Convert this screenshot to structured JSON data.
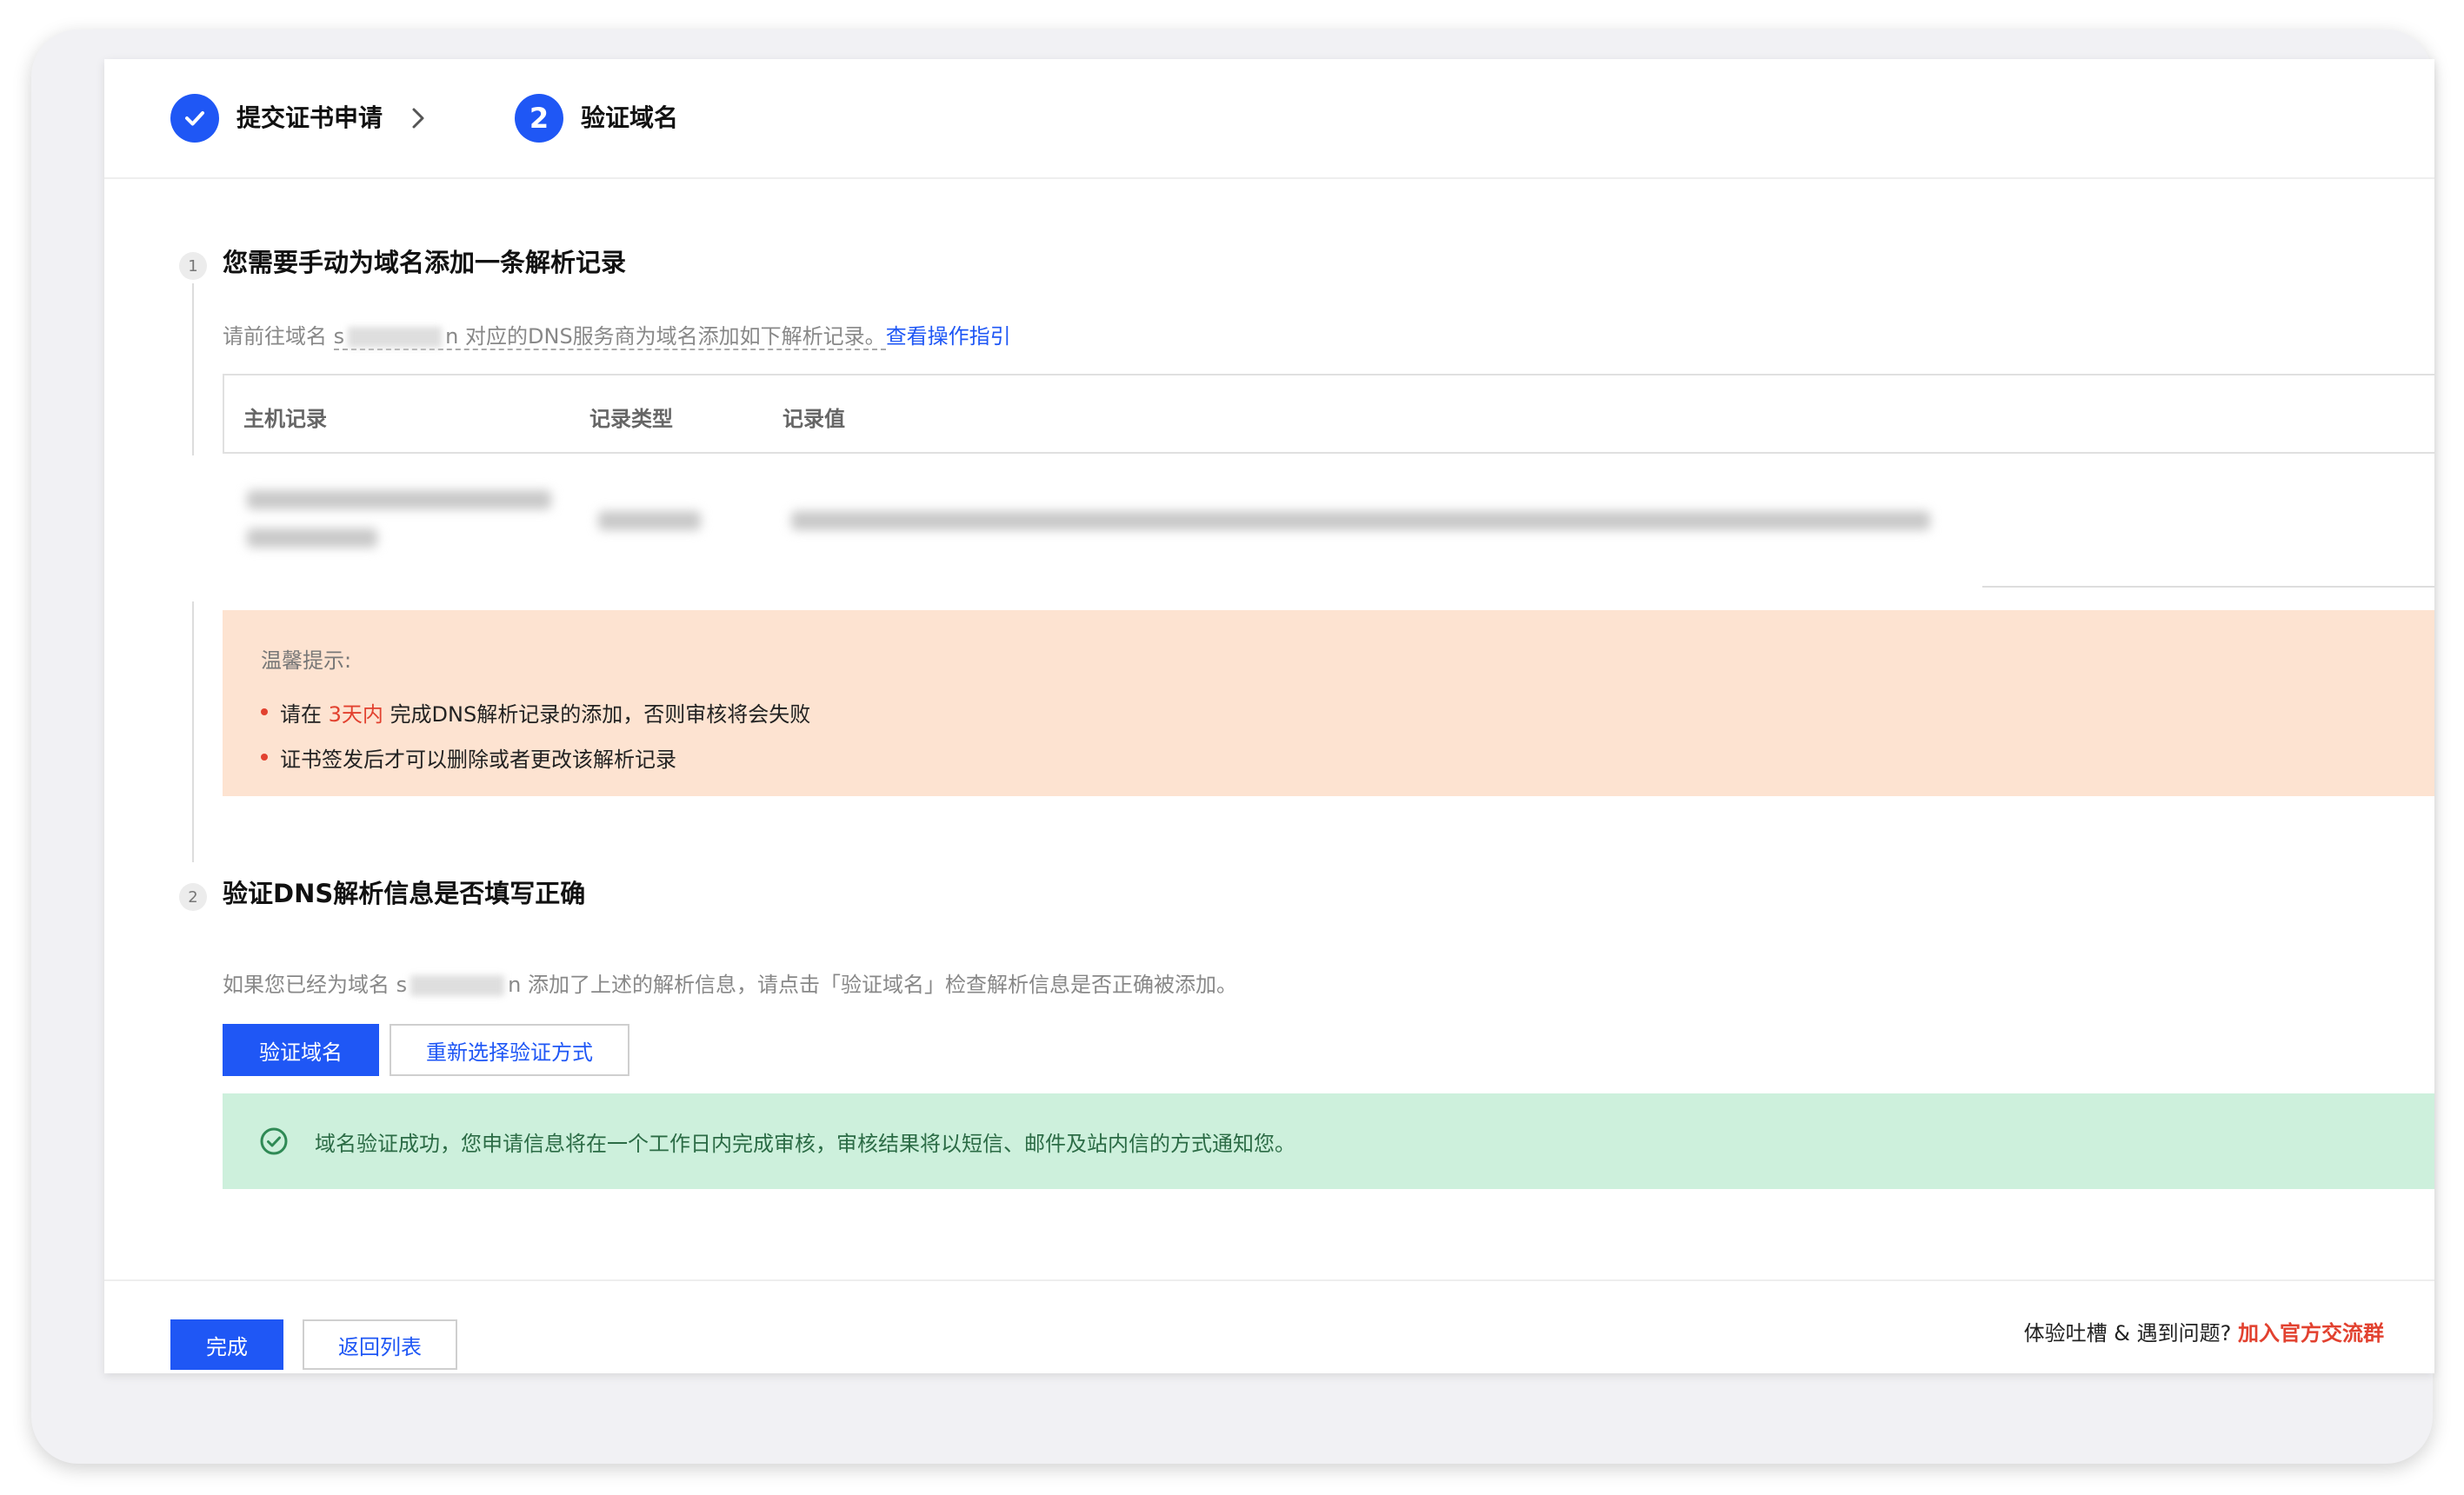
{
  "stepper": {
    "step1": {
      "label": "提交证书申请",
      "status": "done"
    },
    "step2": {
      "number": "2",
      "label": "验证域名",
      "status": "active"
    }
  },
  "section1": {
    "number": "1",
    "title": "您需要手动为域名添加一条解析记录",
    "hint_prefix": "请前往域名",
    "hint_domain_start": "s",
    "hint_domain_end": "n",
    "hint_mid": "对应的DNS服务商为域名添加如下解析记录。",
    "hint_link": "查看操作指引",
    "table": {
      "headers": [
        "主机记录",
        "记录类型",
        "记录值"
      ]
    },
    "tips": {
      "title": "温馨提示:",
      "item1_prefix": "请在",
      "item1_highlight": "3天内",
      "item1_suffix": "完成DNS解析记录的添加，否则审核将会失败",
      "item2": "证书签发后才可以删除或者更改该解析记录"
    }
  },
  "section2": {
    "number": "2",
    "title": "验证DNS解析信息是否填写正确",
    "hint_prefix": "如果您已经为域名",
    "hint_domain_start": "s",
    "hint_domain_end": "n",
    "hint_suffix": "添加了上述的解析信息，请点击「验证域名」检查解析信息是否正确被添加。",
    "verify_button": "验证域名",
    "reselect_button": "重新选择验证方式",
    "success_message": "域名验证成功，您申请信息将在一个工作日内完成审核，审核结果将以短信、邮件及站内信的方式通知您。"
  },
  "footer": {
    "done_button": "完成",
    "back_button": "返回列表",
    "feedback_prefix": "体验吐槽 & 遇到问题?",
    "feedback_link": "加入官方交流群"
  },
  "colors": {
    "primary": "#1f57f5",
    "warning_bg": "#fde3d1",
    "success_bg": "#cdf0dc",
    "danger": "#e2412f"
  }
}
